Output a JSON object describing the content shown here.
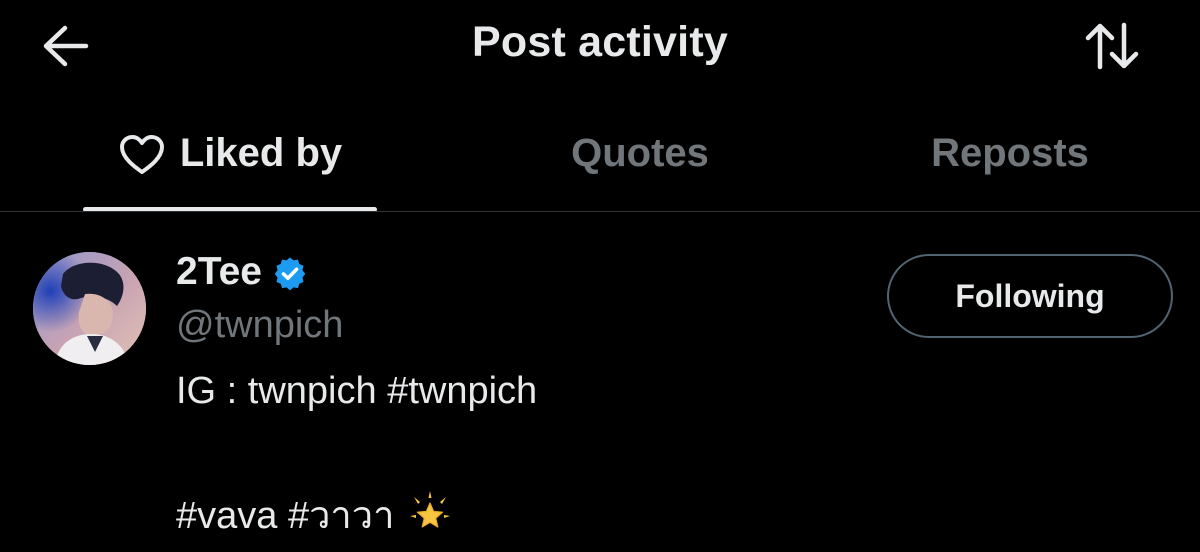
{
  "header": {
    "title": "Post activity",
    "back_icon": "arrow-left-icon",
    "sort_icon": "sort-arrows-icon"
  },
  "tabs": [
    {
      "label": "Liked by",
      "icon": "heart-outline-icon",
      "active": true
    },
    {
      "label": "Quotes",
      "active": false
    },
    {
      "label": "Reposts",
      "active": false
    }
  ],
  "user": {
    "display_name": "2Tee",
    "verified": true,
    "handle": "@twnpich",
    "bio_line1": "IG : twnpich #twnpich",
    "bio_line2": "#vava #วาวา",
    "bio_emoji": "glowing-star-icon",
    "follow_button_label": "Following"
  },
  "colors": {
    "background": "#000000",
    "primary_text": "#e7e9ea",
    "secondary_text": "#71767b",
    "verified_badge": "#1d9bf0",
    "divider": "#2f3336",
    "button_border": "#536471"
  }
}
